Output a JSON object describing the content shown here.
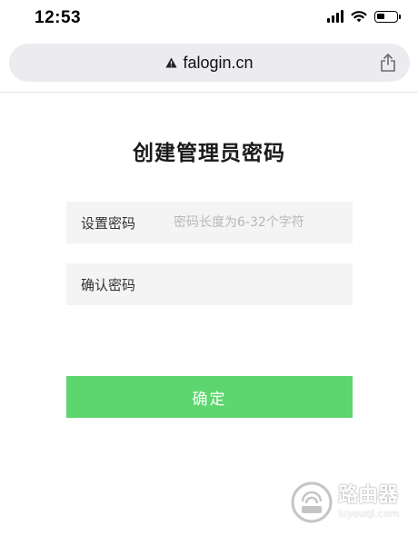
{
  "status_bar": {
    "time": "12:53"
  },
  "address_bar": {
    "url": "falogin.cn",
    "security_icon": "warning-triangle-icon",
    "share_icon": "share-icon"
  },
  "page": {
    "title": "创建管理员密码",
    "fields": [
      {
        "label": "设置密码",
        "placeholder": "密码长度为6-32个字符",
        "value": ""
      },
      {
        "label": "确认密码",
        "placeholder": "",
        "value": ""
      }
    ],
    "confirm_label": "确定"
  },
  "watermark": {
    "text_cn": "路由器",
    "text_en": "luyouqi.com"
  },
  "colors": {
    "accent": "#5dd66f",
    "field_bg": "#f4f4f4",
    "address_bar_bg": "#ececf0"
  }
}
